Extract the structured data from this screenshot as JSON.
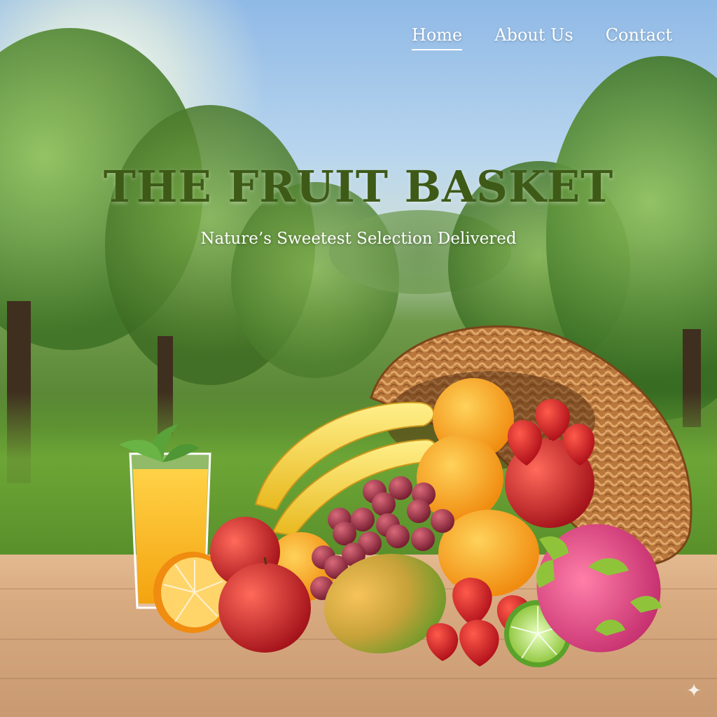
{
  "nav": {
    "items": [
      {
        "label": "Home",
        "active": true
      },
      {
        "label": "About Us",
        "active": false
      },
      {
        "label": "Contact",
        "active": false
      }
    ]
  },
  "hero": {
    "title": "THE FRUIT BASKET",
    "subtitle": "Nature’s Sweetest Selection Delivered"
  },
  "colors": {
    "title": "#3e5a17",
    "nav_text": "#ffffff",
    "sky": "#8fb9e6",
    "orchard": "#4f7f2c",
    "table": "#d8aa80"
  },
  "icons": {
    "corner": "sparkle-icon"
  }
}
